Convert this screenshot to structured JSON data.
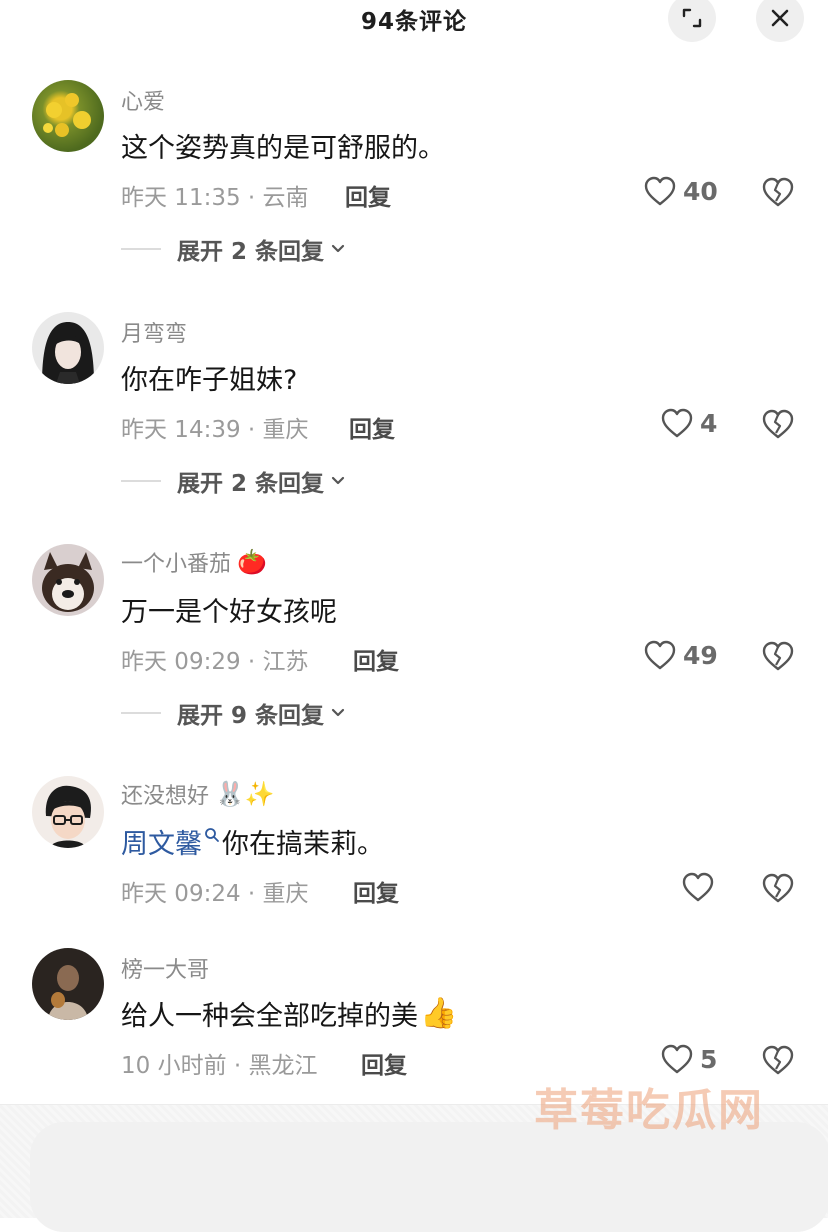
{
  "header": {
    "title": "94条评论"
  },
  "comments": [
    {
      "user": "心爱",
      "text": "这个姿势真的是可舒服的。",
      "time": "昨天 11:35 · 云南",
      "reply": "回复",
      "likes": "40",
      "expand": "展开 2 条回复"
    },
    {
      "user": "月弯弯",
      "text": "你在咋子姐妹?",
      "time": "昨天 14:39 · 重庆",
      "reply": "回复",
      "likes": "4",
      "expand": "展开 2 条回复"
    },
    {
      "user": "一个小番茄",
      "user_emoji": "🍅",
      "text": "万一是个好女孩呢",
      "time": "昨天 09:29 · 江苏",
      "reply": "回复",
      "likes": "49",
      "expand": "展开 9 条回复"
    },
    {
      "user": "还没想好",
      "user_emoji": "🐰✨",
      "mention": "周文馨",
      "text": "你在搞茉莉。",
      "time": "昨天 09:24 · 重庆",
      "reply": "回复",
      "likes": ""
    },
    {
      "user": "榜一大哥",
      "text": "给人一种会全部吃掉的美",
      "text_emoji": "👍",
      "time": "10 小时前 · 黑龙江",
      "reply": "回复",
      "likes": "5"
    }
  ],
  "watermark": "草莓吃瓜网",
  "icons": [
    "expand-icon",
    "close-icon",
    "heart-icon",
    "broken-heart-icon",
    "chevron-down-icon",
    "search-icon"
  ]
}
